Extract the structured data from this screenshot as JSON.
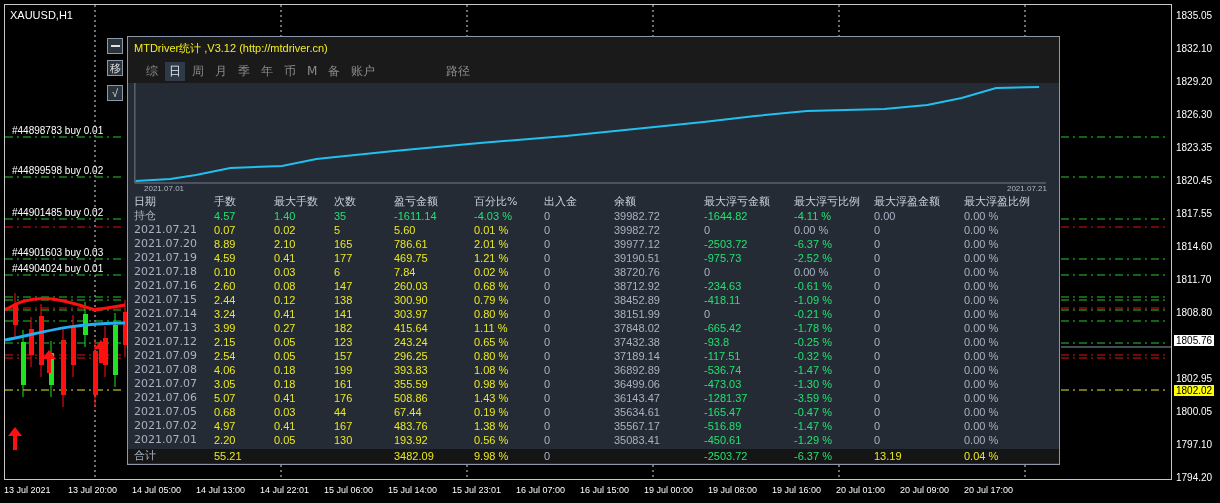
{
  "symbol": "XAUUSD,H1",
  "orders": [
    {
      "label": "#44898783 buy 0.01"
    },
    {
      "label": "#44899598 buy 0.02"
    },
    {
      "label": "#44901485 buy 0.02"
    },
    {
      "label": "#44901603 buy 0.03"
    },
    {
      "label": "#44904024 buy 0.01"
    }
  ],
  "side_buttons": [
    "移",
    "√"
  ],
  "panel": {
    "title": "MTDriver统计 ,V3.12 (http://mtdriver.cn)",
    "tabs": [
      {
        "label": "综",
        "selected": false
      },
      {
        "label": "日",
        "selected": true
      },
      {
        "label": "周",
        "selected": false
      },
      {
        "label": "月",
        "selected": false
      },
      {
        "label": "季",
        "selected": false
      },
      {
        "label": "年",
        "selected": false
      },
      {
        "label": "币",
        "selected": false
      },
      {
        "label": "M",
        "selected": false
      },
      {
        "label": "备",
        "selected": false
      },
      {
        "label": "账户",
        "selected": false
      },
      {
        "label": "路径",
        "selected": false
      }
    ],
    "equity_chart": {
      "start_label": "2021.07.01",
      "end_label": "2021.07.21"
    },
    "table": {
      "columns": [
        "日期",
        "手数",
        "最大手数",
        "次数",
        "盈亏金额",
        "百分比%",
        "出入金",
        "余额",
        "最大浮亏金额",
        "最大浮亏比例",
        "最大浮盈金额",
        "最大浮盈比例"
      ],
      "rows": [
        {
          "kind": "open",
          "cells": [
            "持仓",
            "4.57",
            "1.40",
            "35",
            "-1611.14",
            "-4.03 %",
            "0",
            "39982.72",
            "-1644.82",
            "-4.11 %",
            "0.00",
            "0.00 %"
          ]
        },
        {
          "kind": "day",
          "loss_flat": true,
          "ratio_flat": true,
          "cells": [
            "2021.07.21",
            "0.07",
            "0.02",
            "5",
            "5.60",
            "0.01 %",
            "0",
            "39982.72",
            "0",
            "0.00 %",
            "0",
            "0.00 %"
          ]
        },
        {
          "kind": "day",
          "cells": [
            "2021.07.20",
            "8.89",
            "2.10",
            "165",
            "786.61",
            "2.01 %",
            "0",
            "39977.12",
            "-2503.72",
            "-6.37 %",
            "0",
            "0.00 %"
          ]
        },
        {
          "kind": "day",
          "cells": [
            "2021.07.19",
            "4.59",
            "0.41",
            "177",
            "469.75",
            "1.21 %",
            "0",
            "39190.51",
            "-975.73",
            "-2.52 %",
            "0",
            "0.00 %"
          ]
        },
        {
          "kind": "day",
          "loss_flat": true,
          "ratio_flat": true,
          "cells": [
            "2021.07.18",
            "0.10",
            "0.03",
            "6",
            "7.84",
            "0.02 %",
            "0",
            "38720.76",
            "0",
            "0.00 %",
            "0",
            "0.00 %"
          ]
        },
        {
          "kind": "day",
          "cells": [
            "2021.07.16",
            "2.60",
            "0.08",
            "147",
            "260.03",
            "0.68 %",
            "0",
            "38712.92",
            "-234.63",
            "-0.61 %",
            "0",
            "0.00 %"
          ]
        },
        {
          "kind": "day",
          "cells": [
            "2021.07.15",
            "2.44",
            "0.12",
            "138",
            "300.90",
            "0.79 %",
            "0",
            "38452.89",
            "-418.11",
            "-1.09 %",
            "0",
            "0.00 %"
          ]
        },
        {
          "kind": "day",
          "loss_flat": true,
          "ratio_flat": false,
          "cells": [
            "2021.07.14",
            "3.24",
            "0.41",
            "141",
            "303.97",
            "0.80 %",
            "0",
            "38151.99",
            "0",
            "-0.21 %",
            "0",
            "0.00 %"
          ]
        },
        {
          "kind": "day",
          "cells": [
            "2021.07.13",
            "3.99",
            "0.27",
            "182",
            "415.64",
            "1.11 %",
            "0",
            "37848.02",
            "-665.42",
            "-1.78 %",
            "0",
            "0.00 %"
          ]
        },
        {
          "kind": "day",
          "cells": [
            "2021.07.12",
            "2.15",
            "0.05",
            "123",
            "243.24",
            "0.65 %",
            "0",
            "37432.38",
            "-93.8",
            "-0.25 %",
            "0",
            "0.00 %"
          ]
        },
        {
          "kind": "day",
          "cells": [
            "2021.07.09",
            "2.54",
            "0.05",
            "157",
            "296.25",
            "0.80 %",
            "0",
            "37189.14",
            "-117.51",
            "-0.32 %",
            "0",
            "0.00 %"
          ]
        },
        {
          "kind": "day",
          "cells": [
            "2021.07.08",
            "4.06",
            "0.18",
            "199",
            "393.83",
            "1.08 %",
            "0",
            "36892.89",
            "-536.74",
            "-1.47 %",
            "0",
            "0.00 %"
          ]
        },
        {
          "kind": "day",
          "cells": [
            "2021.07.07",
            "3.05",
            "0.18",
            "161",
            "355.59",
            "0.98 %",
            "0",
            "36499.06",
            "-473.03",
            "-1.30 %",
            "0",
            "0.00 %"
          ]
        },
        {
          "kind": "day",
          "cells": [
            "2021.07.06",
            "5.07",
            "0.41",
            "176",
            "508.86",
            "1.43 %",
            "0",
            "36143.47",
            "-1281.37",
            "-3.59 %",
            "0",
            "0.00 %"
          ]
        },
        {
          "kind": "day",
          "cells": [
            "2021.07.05",
            "0.68",
            "0.03",
            "44",
            "67.44",
            "0.19 %",
            "0",
            "35634.61",
            "-165.47",
            "-0.47 %",
            "0",
            "0.00 %"
          ]
        },
        {
          "kind": "day",
          "cells": [
            "2021.07.02",
            "4.97",
            "0.41",
            "167",
            "483.76",
            "1.38 %",
            "0",
            "35567.17",
            "-516.89",
            "-1.47 %",
            "0",
            "0.00 %"
          ]
        },
        {
          "kind": "day",
          "cells": [
            "2021.07.01",
            "2.20",
            "0.05",
            "130",
            "193.92",
            "0.56 %",
            "0",
            "35083.41",
            "-450.61",
            "-1.29 %",
            "0",
            "0.00 %"
          ]
        },
        {
          "kind": "total",
          "cells": [
            "合计",
            "55.21",
            null,
            null,
            "3482.09",
            "9.98 %",
            "0",
            null,
            "-2503.72",
            "-6.37 %",
            "13.19",
            "0.04 %"
          ]
        }
      ]
    }
  },
  "price_axis": {
    "ticks": [
      "1835.05",
      "1832.10",
      "1829.20",
      "1826.30",
      "1823.35",
      "1820.45",
      "1817.55",
      "1814.60",
      "1811.70",
      "1808.80",
      "1802.95",
      "1800.05",
      "1797.10",
      "1794.20"
    ],
    "bid": "1805.76",
    "ask": "1802.02"
  },
  "time_axis": [
    "13 Jul 2021",
    "13 Jul 20:00",
    "14 Jul 05:00",
    "14 Jul 13:00",
    "14 Jul 22:01",
    "15 Jul 06:00",
    "15 Jul 14:00",
    "15 Jul 23:01",
    "16 Jul 07:00",
    "16 Jul 15:00",
    "19 Jul 00:00",
    "19 Jul 08:00",
    "19 Jul 16:00",
    "20 Jul 01:00",
    "20 Jul 09:00",
    "20 Jul 17:00"
  ]
}
